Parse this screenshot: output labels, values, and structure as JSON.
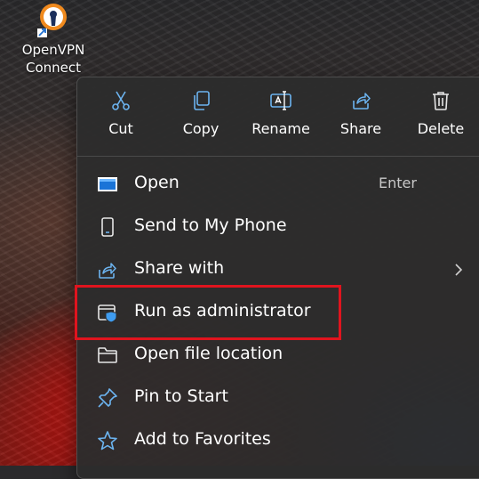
{
  "desktop": {
    "shortcut_label_line1": "OpenVPN",
    "shortcut_label_line2": "Connect",
    "icon": "openvpn-logo"
  },
  "context_menu": {
    "toolbar": [
      {
        "label": "Cut",
        "icon": "scissors-icon"
      },
      {
        "label": "Copy",
        "icon": "copy-icon"
      },
      {
        "label": "Rename",
        "icon": "rename-icon"
      },
      {
        "label": "Share",
        "icon": "share-icon"
      },
      {
        "label": "Delete",
        "icon": "trash-icon"
      }
    ],
    "items": [
      {
        "label": "Open",
        "shortcut": "Enter",
        "icon": "window-icon"
      },
      {
        "label": "Send to My Phone",
        "icon": "phone-icon"
      },
      {
        "label": "Share with",
        "icon": "share-arrow-icon",
        "submenu": true
      },
      {
        "label": "Run as administrator",
        "icon": "shield-window-icon"
      },
      {
        "label": "Open file location",
        "icon": "folder-icon"
      },
      {
        "label": "Pin to Start",
        "icon": "pin-icon"
      },
      {
        "label": "Add to Favorites",
        "icon": "star-icon"
      }
    ]
  },
  "colors": {
    "menu_bg": "#2c2c2c",
    "accent_icon": "#6cb4f0",
    "highlight": "#e0141e"
  }
}
